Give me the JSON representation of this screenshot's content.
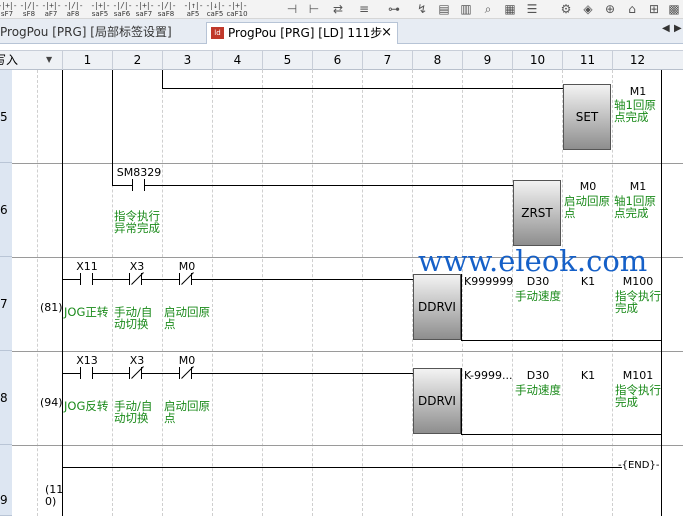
{
  "toolbar": {
    "fkeys": [
      {
        "icon": "-|+|-",
        "label": "sF7"
      },
      {
        "icon": "-|/|-",
        "label": "sF8"
      },
      {
        "icon": "-|+|-",
        "label": "aF7"
      },
      {
        "icon": "-|/|-",
        "label": "aF8"
      },
      {
        "icon": "-|+|-",
        "label": "saF5"
      },
      {
        "icon": "-|/|-",
        "label": "saF6"
      },
      {
        "icon": "-|+|-",
        "label": "saF7"
      },
      {
        "icon": "-|/|-",
        "label": "saF8"
      },
      {
        "icon": "-|↑|-",
        "label": "aF5"
      },
      {
        "icon": "-|↓|-",
        "label": "caF5"
      },
      {
        "icon": "-|+|-",
        "label": "caF10"
      }
    ],
    "icons": [
      "ladder-tool-icon",
      "ladder-tool-icon",
      "ladder-tool-icon",
      "ladder-tool-icon",
      "ladder-tool-icon",
      "ladder-tool-icon",
      "ladder-tool-icon",
      "ladder-tool-icon",
      "ladder-tool-icon",
      "ladder-tool-icon",
      "ladder-tool-icon",
      "ladder-tool-icon",
      "ladder-tool-icon",
      "ladder-tool-icon",
      "ladder-tool-icon"
    ]
  },
  "tabs": {
    "tab1": "ProgPou [PRG] [局部标签设置]",
    "tab2": "ProgPou [PRG] [LD] 111步",
    "tab2_icon": "ld",
    "close": "×",
    "nav_left": "◀",
    "nav_right": "▶"
  },
  "header": {
    "corner": "写入",
    "columns": [
      "1",
      "2",
      "3",
      "4",
      "5",
      "6",
      "7",
      "8",
      "9",
      "10",
      "11",
      "12"
    ]
  },
  "rows": [
    {
      "num": "5",
      "step": ""
    },
    {
      "num": "6",
      "step": ""
    },
    {
      "num": "7",
      "step": "(81)"
    },
    {
      "num": "8",
      "step": "(94)"
    },
    {
      "num": "9",
      "step": "(11\n0)"
    }
  ],
  "ladder": {
    "r5": {
      "instr": "SET",
      "dev": "M1",
      "comment": "轴1回原点完成"
    },
    "r6": {
      "contact_dev": "SM8329",
      "contact_cmt": "指令执行异常完成",
      "instr": "ZRST",
      "op1": "M0",
      "op1_cmt": "启动回原点",
      "op2": "M1",
      "op2_cmt": "轴1回原点完成"
    },
    "r7": {
      "c1": "X11",
      "c1_cmt": "JOG正转",
      "c2": "X3",
      "c2_cmt": "手动/自动切换",
      "c3": "M0",
      "c3_cmt": "启动回原点",
      "instr": "DDRVI",
      "op1": "K999999",
      "op2": "D30",
      "op2_cmt": "手动速度",
      "op3": "K1",
      "op4": "M100",
      "op4_cmt": "指令执行完成"
    },
    "r8": {
      "c1": "X13",
      "c1_cmt": "JOG反转",
      "c2": "X3",
      "c2_cmt": "手动/自动切换",
      "c3": "M0",
      "c3_cmt": "启动回原点",
      "instr": "DDRVI",
      "op1": "K-9999...",
      "op2": "D30",
      "op2_cmt": "手动速度",
      "op3": "K1",
      "op4": "M101",
      "op4_cmt": "指令执行完成"
    },
    "r9": {
      "end": "-{END}-"
    }
  },
  "watermark": "www.eleok.com"
}
